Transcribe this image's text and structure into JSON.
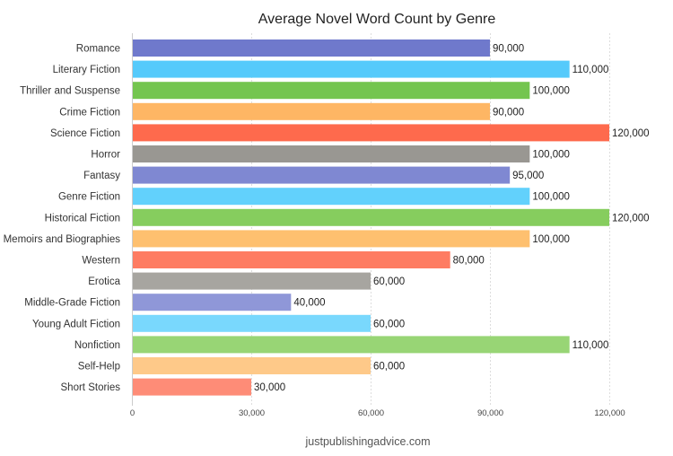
{
  "chart_data": {
    "type": "bar",
    "orientation": "horizontal",
    "title": "Average Novel Word Count by Genre",
    "xlabel": "",
    "ylabel": "",
    "xlim": [
      0,
      120000
    ],
    "xticks": [
      0,
      30000,
      60000,
      90000,
      120000
    ],
    "xtick_labels": [
      "0",
      "30,000",
      "60,000",
      "90,000",
      "120,000"
    ],
    "grid": true,
    "legend": "none",
    "categories": [
      "Romance",
      "Literary Fiction",
      "Thriller and Suspense",
      "Crime Fiction",
      "Science Fiction",
      "Horror",
      "Fantasy",
      "Genre Fiction",
      "Historical Fiction",
      "Memoirs and Biographies",
      "Western",
      "Erotica",
      "Middle-Grade Fiction",
      "Young Adult Fiction",
      "Nonfiction",
      "Self-Help",
      "Short Stories"
    ],
    "values": [
      90000,
      110000,
      100000,
      90000,
      120000,
      100000,
      95000,
      100000,
      120000,
      100000,
      80000,
      60000,
      40000,
      60000,
      110000,
      60000,
      30000
    ],
    "value_labels": [
      "90,000",
      "110,000",
      "100,000",
      "90,000",
      "120,000",
      "100,000",
      "95,000",
      "100,000",
      "120,000",
      "100,000",
      "80,000",
      "60,000",
      "40,000",
      "60,000",
      "110,000",
      "60,000",
      "30,000"
    ],
    "colors": [
      "#6f79cc",
      "#55cafb",
      "#74c54f",
      "#feb664",
      "#fe6a4d",
      "#999792",
      "#7f88d2",
      "#62d1fc",
      "#86cd5e",
      "#fec06f",
      "#fe7c62",
      "#a7a5a0",
      "#8f97d8",
      "#79d8fd",
      "#98d575",
      "#fec989",
      "#fe8c77"
    ]
  },
  "source": "justpublishingadvice.com"
}
